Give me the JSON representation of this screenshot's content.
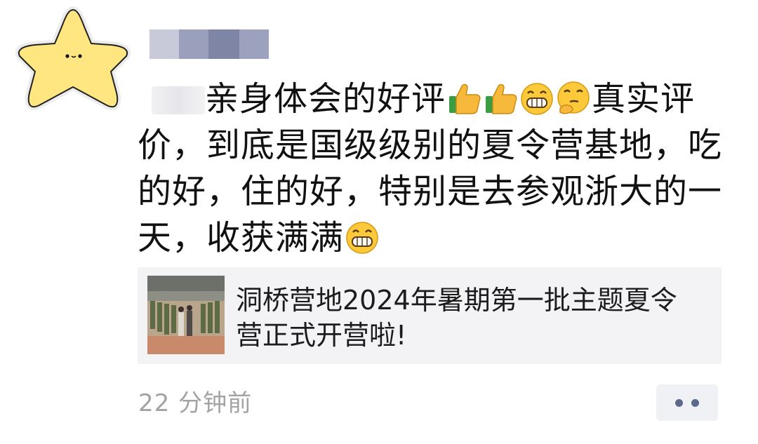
{
  "post": {
    "lines": [
      {
        "text_a": "亲身体会的好评",
        "text_b": "真实评"
      },
      {
        "text": "价，到底是国级级别的夏令营基地，吃"
      },
      {
        "text": "的好，住的好，特别是去参观浙大的一"
      },
      {
        "text": "天，收获满满"
      }
    ],
    "emojis": [
      "thumbs-up",
      "thumbs-up",
      "grinning-face",
      "thinking-face",
      "grinning-face"
    ]
  },
  "link": {
    "title": "洞桥营地2024年暑期第一批主题夏令营正式开营啦!"
  },
  "footer": {
    "timestamp": "22 分钟前"
  },
  "colors": {
    "text": "#111111",
    "card_bg": "#f3f3f5",
    "timestamp": "#a3a3a3",
    "more_dots": "#5c6a89",
    "avatar_star": "#ffe680"
  }
}
